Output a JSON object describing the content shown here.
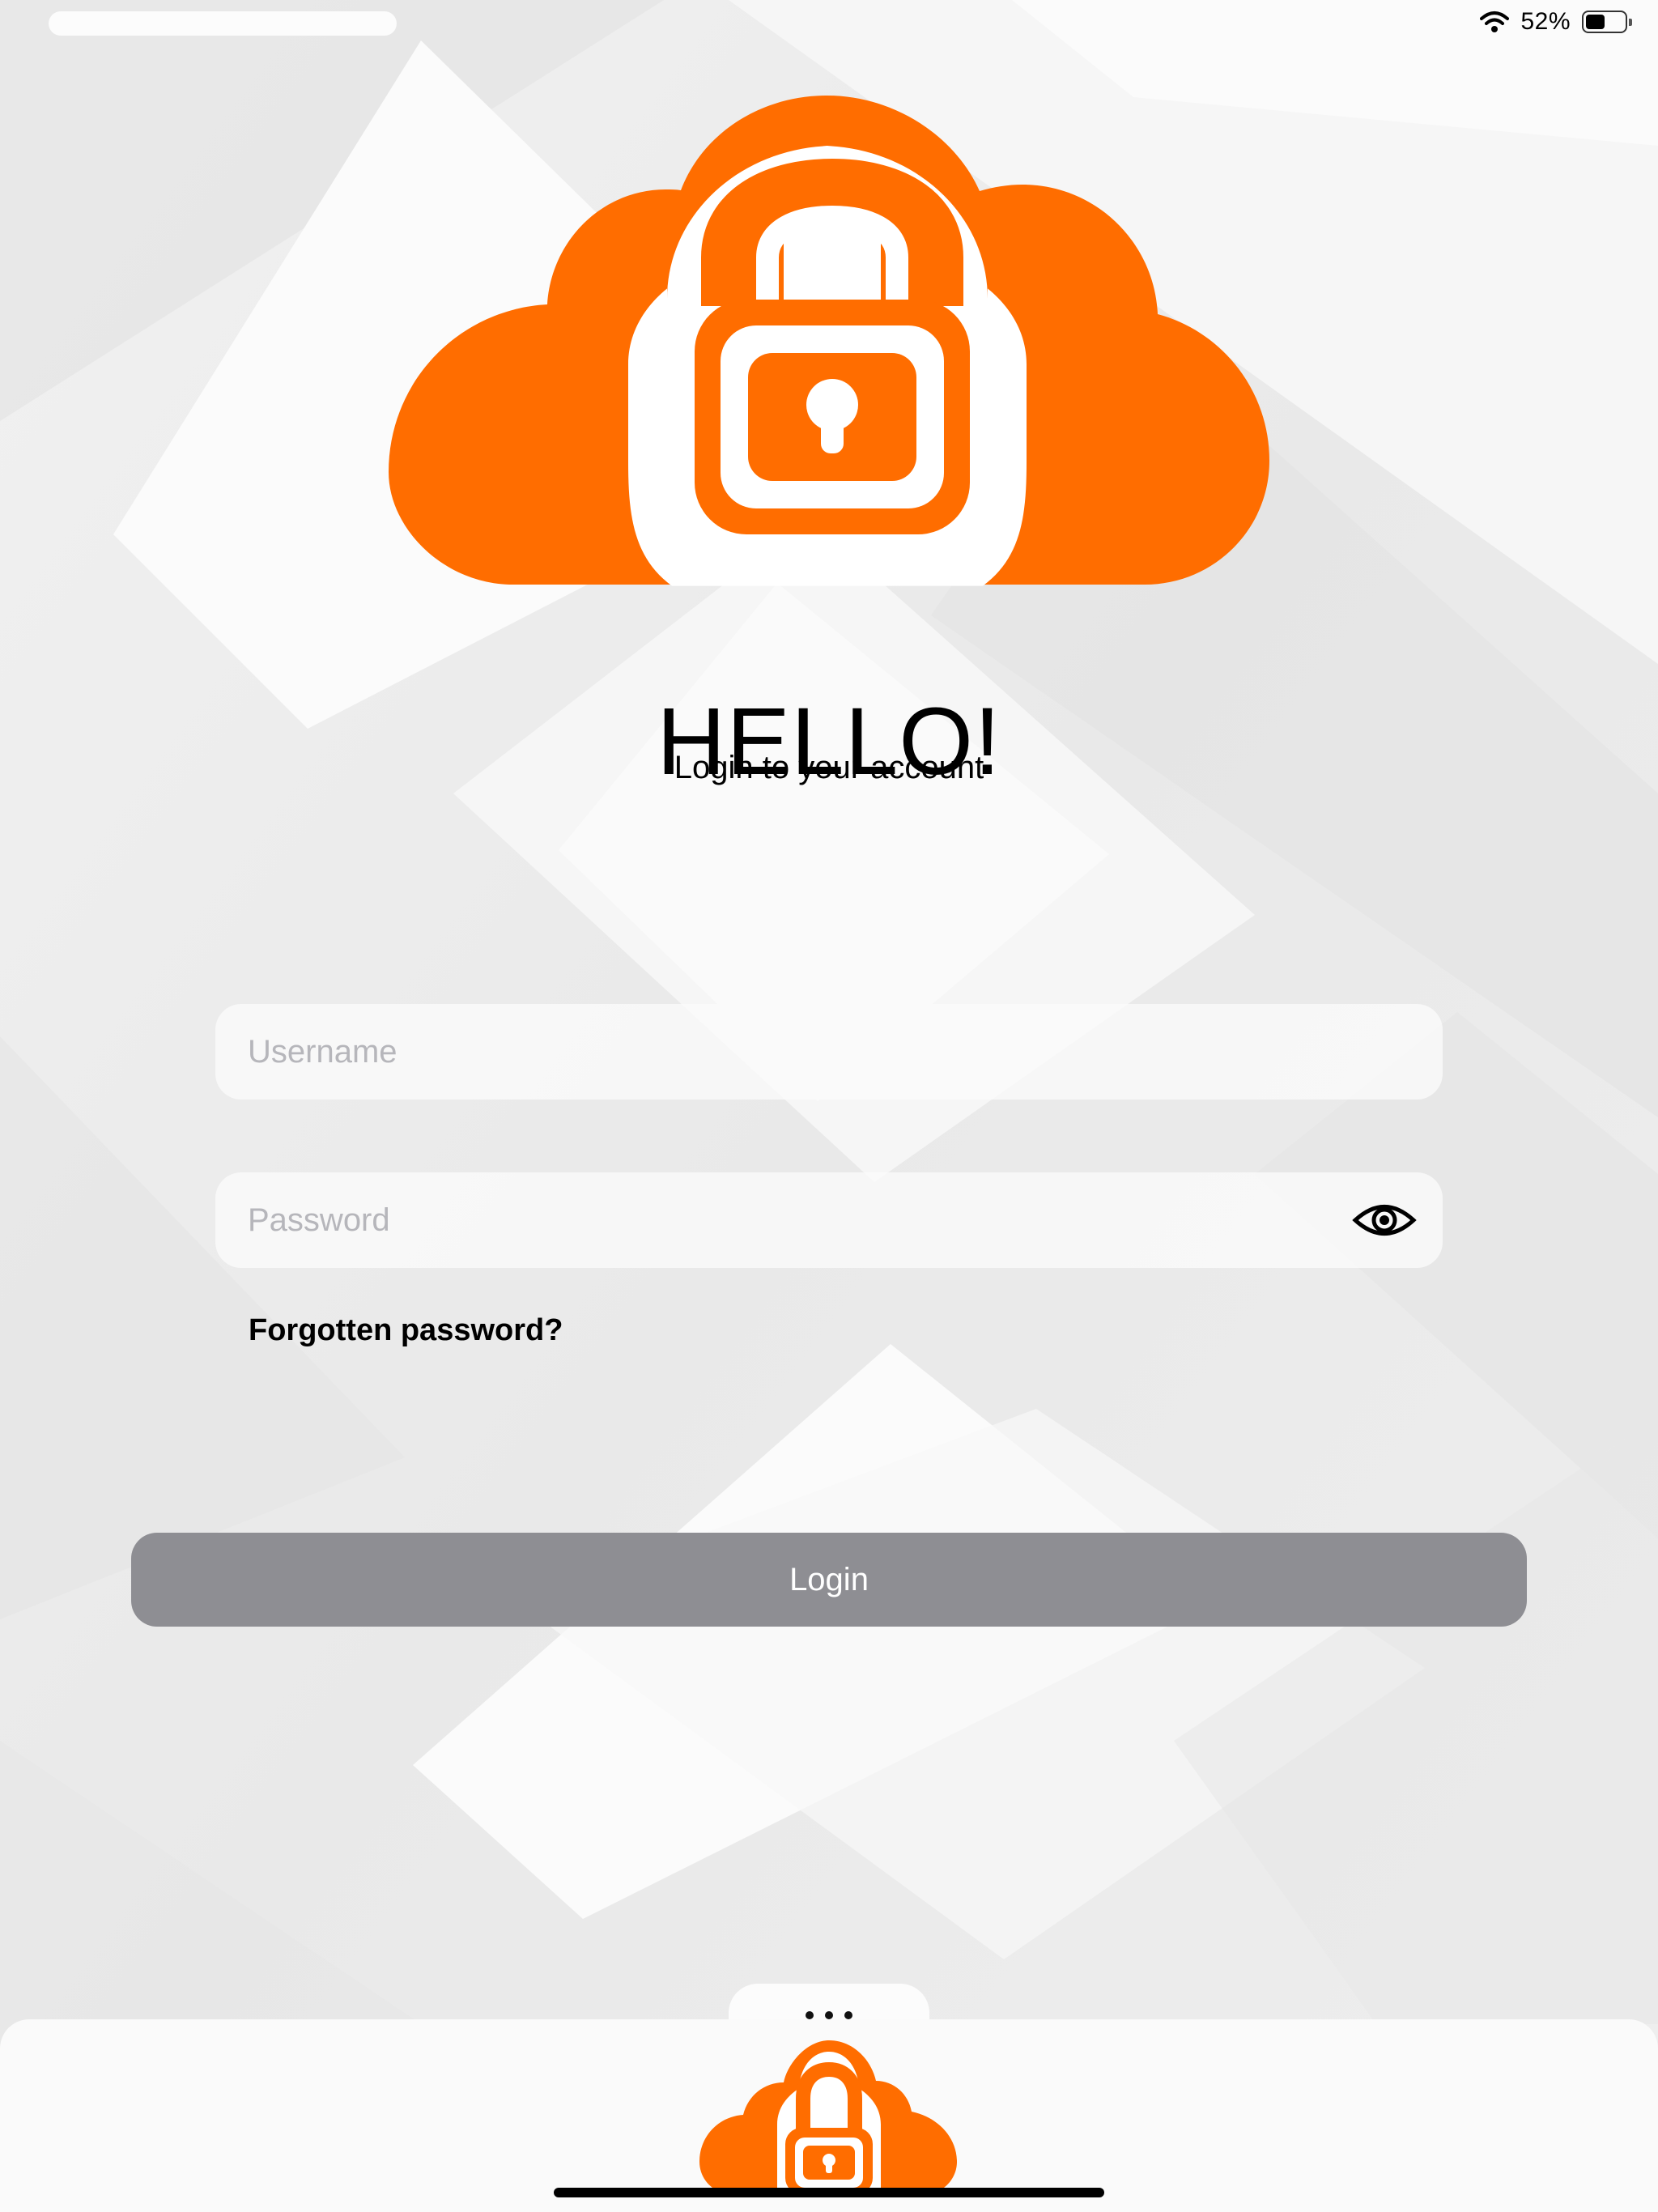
{
  "status_bar": {
    "battery_text": "52%",
    "battery_level": 0.52,
    "wifi_icon": "wifi-icon"
  },
  "brand": {
    "accent_color": "#FF6D00",
    "logo_icon": "cloud-lock-icon"
  },
  "header": {
    "title": "HELLO!",
    "subtitle": "Login to your account"
  },
  "form": {
    "username_placeholder": "Username",
    "username_value": "",
    "password_placeholder": "Password",
    "password_value": "",
    "show_password_icon": "eye-icon",
    "forgot_password_label": "Forgotten password?",
    "login_label": "Login",
    "login_button_color": "#8E8E93"
  },
  "bottom_sheet": {
    "more_icon": "ellipsis-icon",
    "app_icon": "cloud-lock-icon"
  }
}
